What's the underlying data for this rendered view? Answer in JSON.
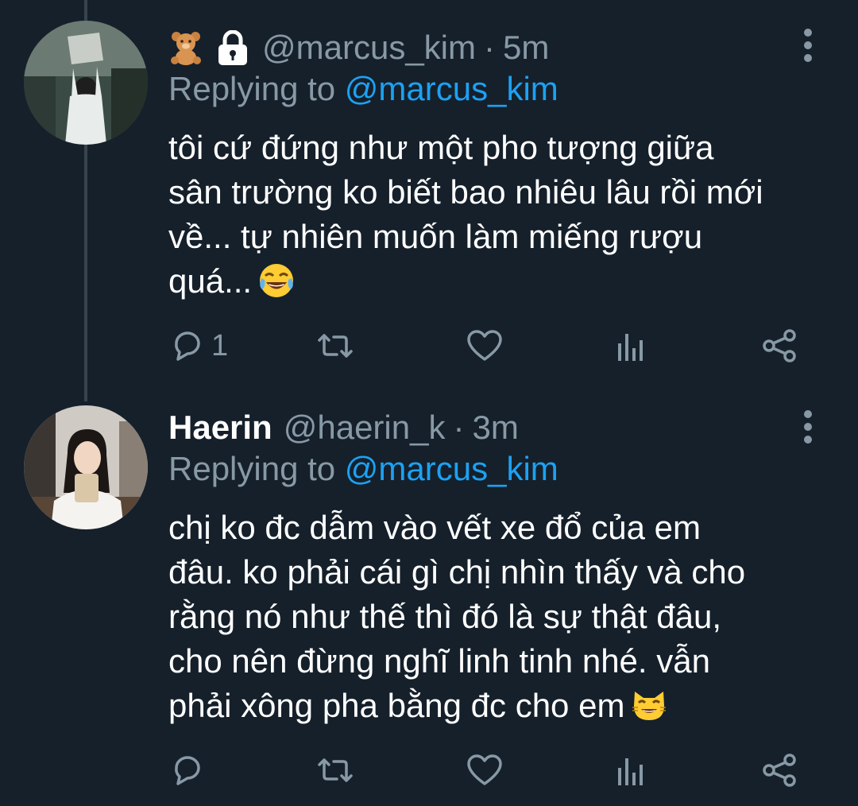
{
  "tweets": [
    {
      "display_name": "",
      "handle": "@marcus_kim",
      "separator": "·",
      "time": "5m",
      "badges": [
        "teddy-bear-emoji",
        "locked-account-icon"
      ],
      "replying_label": "Replying to",
      "replying_to": "@marcus_kim",
      "text_lines": [
        "tôi cứ đứng như một pho tượng giữa",
        "sân trường ko biết bao nhiêu lâu rồi mới",
        "về... tự nhiên muốn làm miếng rượu",
        "quá..."
      ],
      "trailing_emoji": "face-with-tears-of-joy-emoji",
      "actions": {
        "reply_count": "1",
        "retweet_count": "",
        "like_count": ""
      }
    },
    {
      "display_name": "Haerin",
      "handle": "@haerin_k",
      "separator": "·",
      "time": "3m",
      "badges": [],
      "replying_label": "Replying to",
      "replying_to": "@marcus_kim",
      "text_lines": [
        "chị ko đc dẫm vào vết xe đổ của em",
        "đâu. ko phải cái gì chị nhìn thấy và cho",
        "rằng nó như thế thì đó là sự thật đâu,",
        "cho nên đừng nghĩ linh tinh nhé. vẫn",
        "phải xông pha bằng đc cho em"
      ],
      "trailing_emoji": "grinning-cat-emoji",
      "actions": {
        "reply_count": "",
        "retweet_count": "",
        "like_count": ""
      }
    }
  ],
  "icons": {
    "reply": "reply-icon",
    "retweet": "retweet-icon",
    "like": "like-icon",
    "analytics": "analytics-icon",
    "share": "share-icon",
    "more": "more-options-icon"
  },
  "colors": {
    "background": "#15202b",
    "text_primary": "#ffffff",
    "text_secondary": "#8899a6",
    "link": "#1da1f2",
    "thread_line": "#38444d"
  }
}
